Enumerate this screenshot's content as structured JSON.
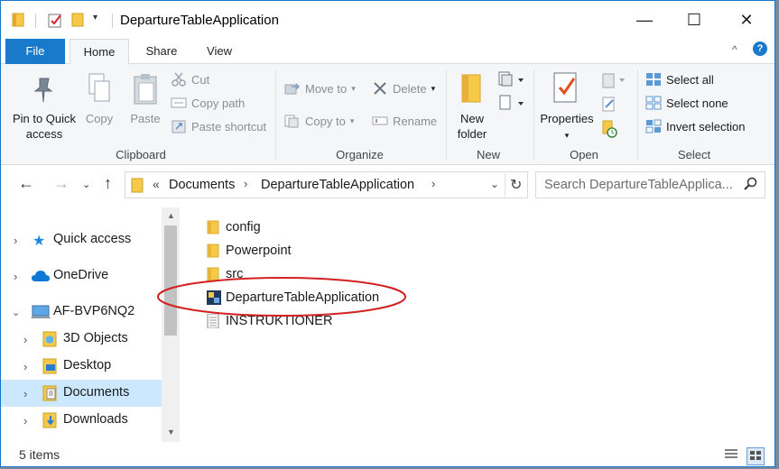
{
  "window": {
    "title": "DepartureTableApplication",
    "controls": {
      "minimize": "—",
      "maximize": "☐",
      "close": "✕"
    }
  },
  "ribbon_tabs": {
    "file": "File",
    "home": "Home",
    "share": "Share",
    "view": "View"
  },
  "ribbon": {
    "clipboard": {
      "label": "Clipboard",
      "pin_line1": "Pin to Quick",
      "pin_line2": "access",
      "copy": "Copy",
      "paste": "Paste",
      "cut": "Cut",
      "copy_path": "Copy path",
      "paste_shortcut": "Paste shortcut"
    },
    "organize": {
      "label": "Organize",
      "move_to": "Move to",
      "copy_to": "Copy to",
      "delete": "Delete",
      "rename": "Rename"
    },
    "new": {
      "label": "New",
      "new_folder_line1": "New",
      "new_folder_line2": "folder"
    },
    "open": {
      "label": "Open",
      "properties": "Properties"
    },
    "select": {
      "label": "Select",
      "select_all": "Select all",
      "select_none": "Select none",
      "invert_selection": "Invert selection"
    }
  },
  "address": {
    "overflow": "«",
    "breadcrumb": [
      "Documents",
      "DepartureTableApplication"
    ],
    "search_placeholder": "Search DepartureTableApplica..."
  },
  "nav_pane": {
    "items": [
      {
        "label": "Quick access",
        "icon": "star-icon"
      },
      {
        "label": "OneDrive",
        "icon": "cloud-icon"
      },
      {
        "label": "AF-BVP6NQ2",
        "icon": "computer-icon"
      },
      {
        "label": "3D Objects",
        "icon": "3d-objects-icon"
      },
      {
        "label": "Desktop",
        "icon": "desktop-icon"
      },
      {
        "label": "Documents",
        "icon": "documents-icon"
      },
      {
        "label": "Downloads",
        "icon": "downloads-icon"
      }
    ]
  },
  "files": [
    {
      "name": "config",
      "type": "folder"
    },
    {
      "name": "Powerpoint",
      "type": "folder"
    },
    {
      "name": "src",
      "type": "folder"
    },
    {
      "name": "DepartureTableApplication",
      "type": "application"
    },
    {
      "name": "INSTRUKTIONER",
      "type": "text"
    }
  ],
  "status": {
    "item_count": "5 items"
  },
  "colors": {
    "accent": "#1979ca",
    "selection": "#cce8ff",
    "annotation": "#d42020",
    "folder": "#f7c948"
  }
}
